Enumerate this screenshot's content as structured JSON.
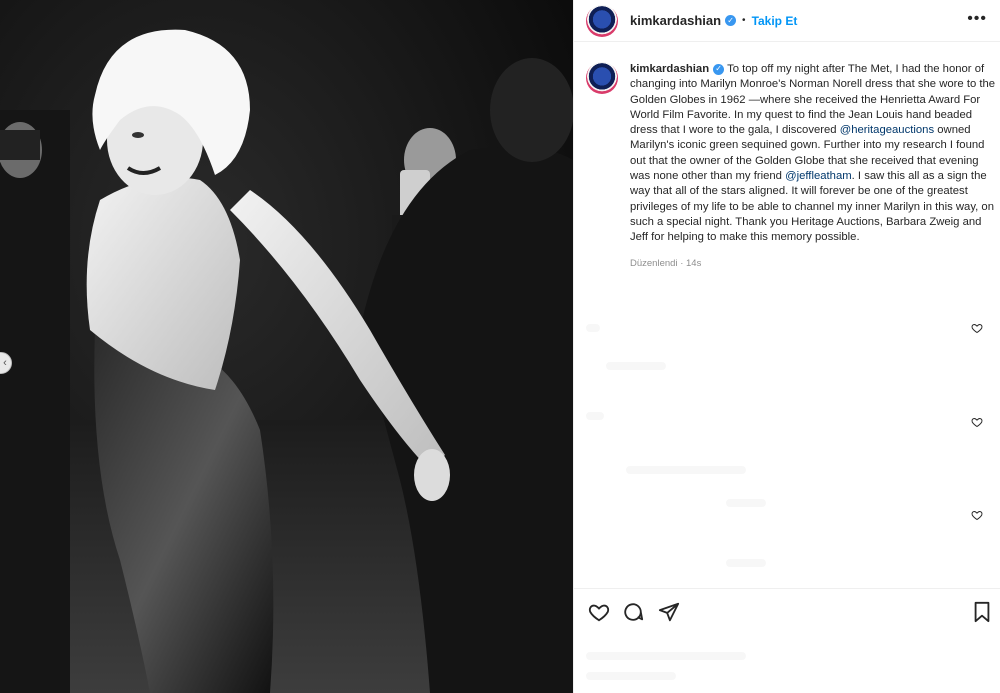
{
  "post": {
    "username": "kimkardashian",
    "verified_glyph": "✓",
    "separator": "•",
    "follow_label": "Takip Et",
    "more_label": "•••",
    "carousel_prev_glyph": "‹",
    "photo_description_icon": "black-and-white-photo"
  },
  "caption": {
    "username": "kimkardashian",
    "part1": "To top off my night after The Met, I had the honor of changing into Marilyn Monroe's Norman Norell dress that she wore to the Golden Globes in 1962 —where she received the Henrietta Award For World Film Favorite. In my quest to find the Jean Louis hand beaded dress that I wore to the gala, I discovered ",
    "mention1": "@heritageauctions",
    "part2": " owned Marilyn's iconic green sequined gown. Further into my research I found out that the owner of the Golden Globe that she received that evening was none other than my friend ",
    "mention2": "@jeffleatham",
    "part3": ". I saw this all as a sign the way that all of the stars aligned. It will forever be one of the greatest privileges of my life to be able to channel my inner Marilyn in this way, on such a special night. Thank you Heritage Auctions, Barbara Zweig and Jeff for helping to make this memory possible.",
    "edited_label": "Düzenlendi",
    "dot": "·",
    "time_ago": "14s"
  },
  "icons": {
    "like": "heart-icon",
    "comment": "comment-icon",
    "share": "share-icon",
    "save": "bookmark-icon"
  },
  "colors": {
    "link_blue": "#0095f6",
    "mention": "#00376b",
    "meta_gray": "#8e8e8e"
  }
}
